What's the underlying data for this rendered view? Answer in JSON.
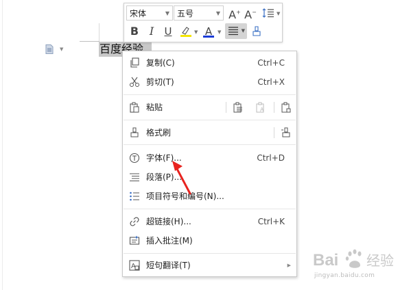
{
  "document": {
    "selected_text": "百度经验"
  },
  "toolbar": {
    "font_name": "宋体",
    "font_size": "五号",
    "grow_font_glyph": "A",
    "shrink_font_glyph": "A",
    "bold_glyph": "B",
    "italic_glyph": "I",
    "underline_glyph": "U",
    "font_color_glyph": "A",
    "highlight_color": "#f5e600",
    "font_color": "#1a3bd6"
  },
  "context_menu": {
    "copy": {
      "label": "复制(C)",
      "shortcut": "Ctrl+C"
    },
    "cut": {
      "label": "剪切(T)",
      "shortcut": "Ctrl+X"
    },
    "paste": {
      "label": "粘贴"
    },
    "format_painter": {
      "label": "格式刷"
    },
    "font": {
      "label": "字体(F)...",
      "shortcut": "Ctrl+D"
    },
    "paragraph": {
      "label": "段落(P)..."
    },
    "bullets": {
      "label": "项目符号和编号(N)..."
    },
    "hyperlink": {
      "label": "超链接(H)...",
      "shortcut": "Ctrl+K"
    },
    "comment": {
      "label": "插入批注(M)"
    },
    "translate": {
      "label": "短句翻译(T)"
    }
  },
  "annotation": {
    "arrow_color": "#e8231f"
  },
  "watermark": {
    "brand": "Bai 经验",
    "url": "jingyan.baidu.com"
  }
}
